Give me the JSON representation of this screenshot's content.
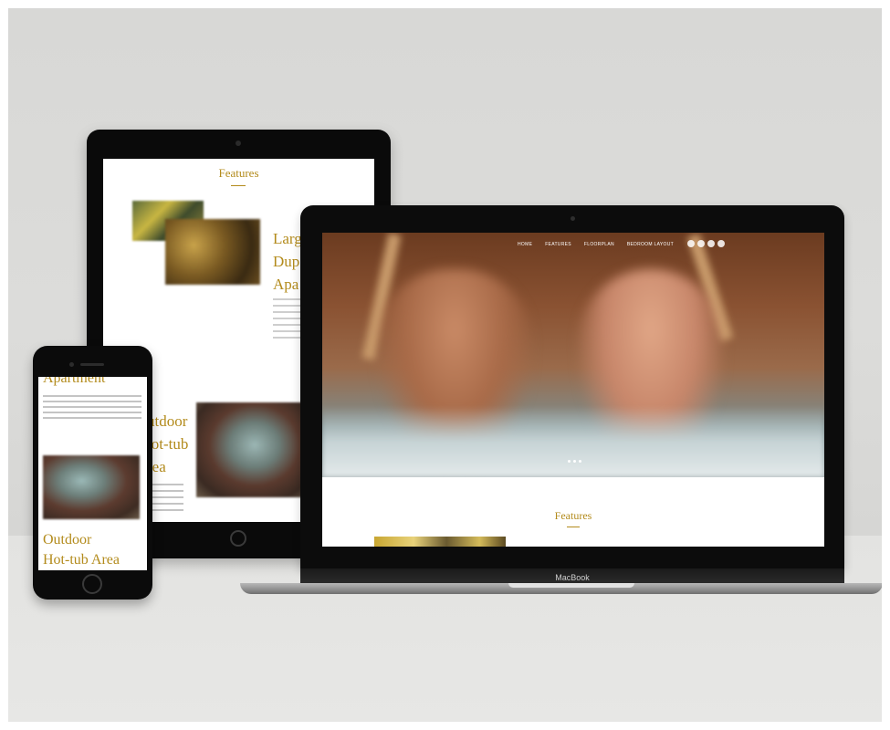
{
  "tablet": {
    "title": "Features",
    "heading_1": "Larg\nDup\nApa",
    "heading_2": "utdoor\nlot-tub\nrea"
  },
  "phone": {
    "heading_top": "Apartment",
    "heading_bottom": "Outdoor\nHot-tub Area"
  },
  "laptop": {
    "nav": [
      "HOME",
      "FEATURES",
      "FLOORPLAN",
      "BEDROOM LAYOUT"
    ],
    "section_title": "Features",
    "brand": "MacBook"
  }
}
